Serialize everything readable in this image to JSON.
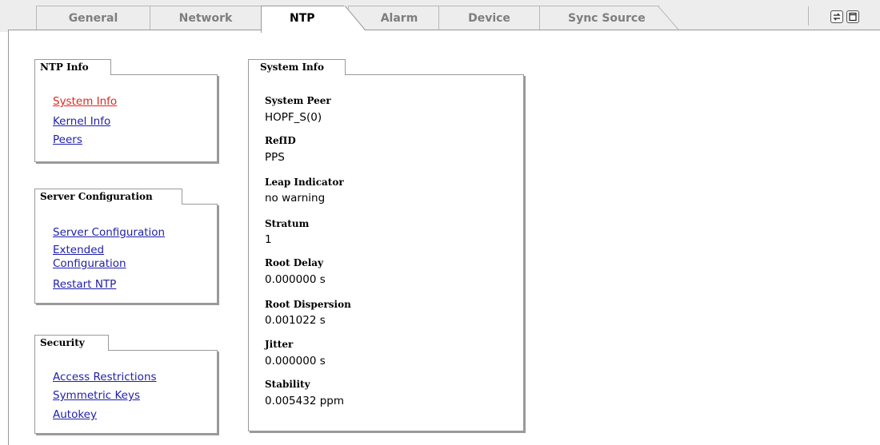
{
  "tabs": [
    {
      "label": "General"
    },
    {
      "label": "Network"
    },
    {
      "label": "NTP"
    },
    {
      "label": "Alarm"
    },
    {
      "label": "Device"
    },
    {
      "label": "Sync Source"
    }
  ],
  "active_tab": "NTP",
  "toolbar_icons": [
    "refresh-icon",
    "window-icon"
  ],
  "ntp_info": {
    "title": "NTP Info",
    "links": [
      "System Info",
      "Kernel Info",
      "Peers"
    ]
  },
  "server_config": {
    "title": "Server Configuration",
    "links": [
      "Server Configuration",
      "Extended",
      "Configuration",
      "Restart NTP"
    ]
  },
  "security": {
    "title": "Security",
    "links": [
      "Access Restrictions",
      "Symmetric Keys",
      "Autokey"
    ]
  },
  "system_info": {
    "title": "System Info",
    "fields": [
      {
        "label": "System Peer",
        "value": "HOPF_S(0)"
      },
      {
        "label": "RefID",
        "value": "PPS"
      },
      {
        "label": "Leap Indicator",
        "value": "no warning"
      },
      {
        "label": "Stratum",
        "value": "1"
      },
      {
        "label": "Root Delay",
        "value": "0.000000 s"
      },
      {
        "label": "Root Dispersion",
        "value": "0.001022 s"
      },
      {
        "label": "Jitter",
        "value": "0.000000 s"
      },
      {
        "label": "Stability",
        "value": "0.005432 ppm"
      }
    ]
  },
  "colors": {
    "link": "#1f1faa",
    "link_current": "#e0261e",
    "tab_inactive_text": "#7e7e7e"
  }
}
